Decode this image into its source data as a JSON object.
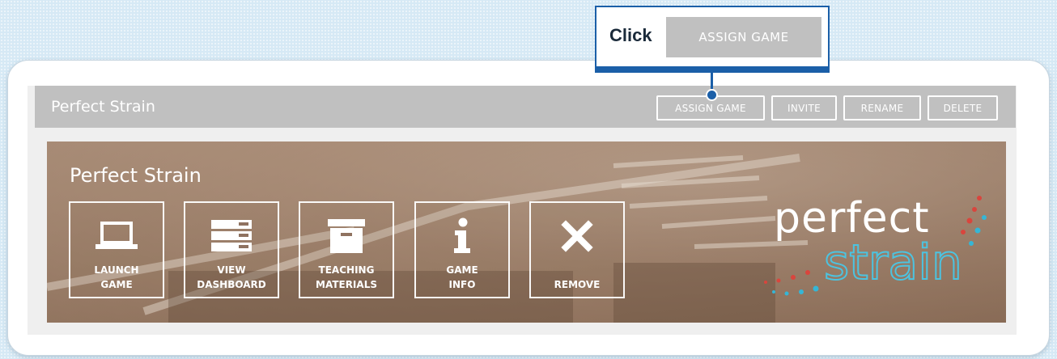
{
  "callout": {
    "click_text": "Click",
    "button_label": "ASSIGN GAME"
  },
  "header": {
    "title": "Perfect Strain",
    "buttons": [
      "ASSIGN GAME",
      "INVITE",
      "RENAME",
      "DELETE"
    ]
  },
  "banner": {
    "title": "Perfect Strain",
    "tiles": [
      {
        "label": "LAUNCH\nGAME",
        "icon": "laptop-icon"
      },
      {
        "label": "VIEW\nDASHBOARD",
        "icon": "dashboard-icon"
      },
      {
        "label": "TEACHING\nMATERIALS",
        "icon": "archive-box-icon"
      },
      {
        "label": "GAME\nINFO",
        "icon": "info-icon"
      },
      {
        "label": "REMOVE",
        "icon": "close-x-icon"
      }
    ],
    "logo_text_top": "perfect",
    "logo_text_bottom": "strain"
  },
  "colors": {
    "callout_accent": "#1b5fa8",
    "header_bar": "#c0c0c0",
    "logo_dots_red": "#d9453d",
    "logo_dots_cyan": "#35b6d6"
  }
}
